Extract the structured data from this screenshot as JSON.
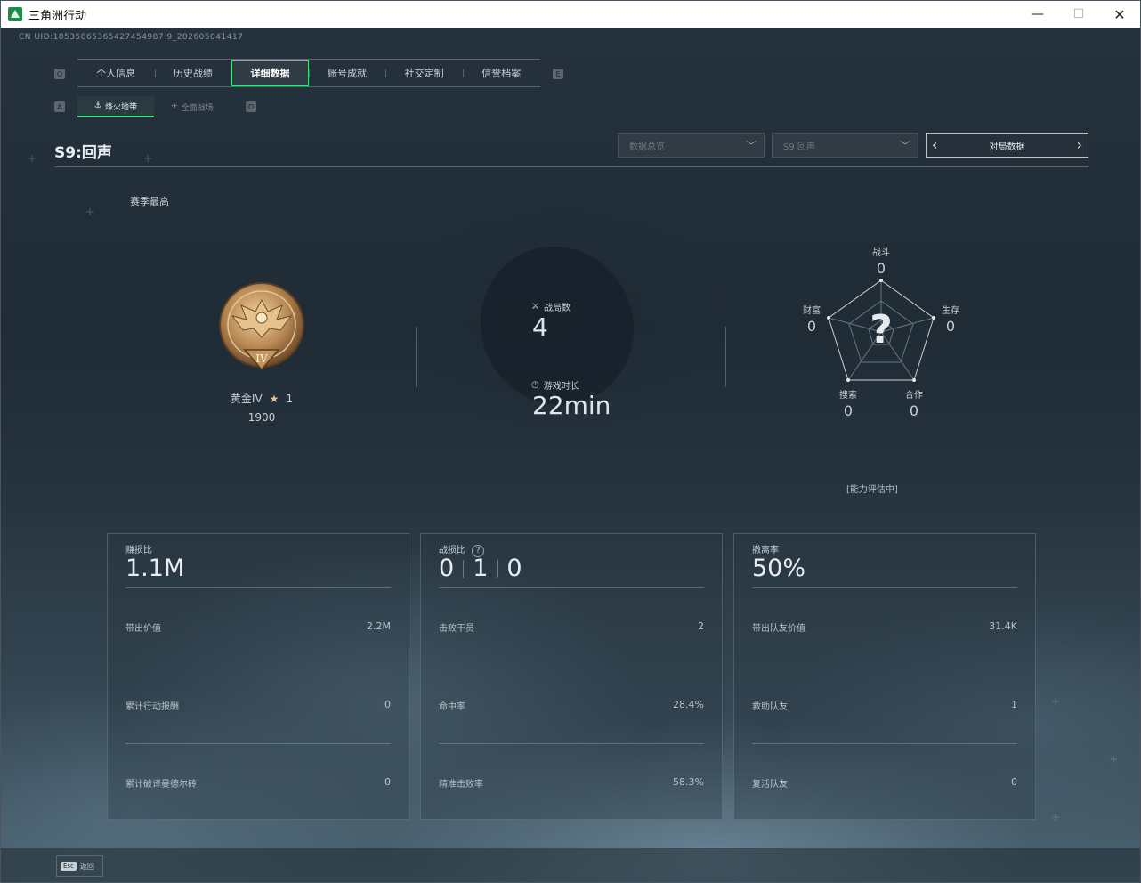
{
  "window": {
    "title": "三角洲行动",
    "min": "—",
    "max": "☐",
    "close": "✕"
  },
  "uid": "CN UID:18535865365427454987 9_202605041417",
  "tabs": {
    "left_key": "Q",
    "right_key": "E",
    "items": [
      "个人信息",
      "历史战绩",
      "详细数据",
      "账号成就",
      "社交定制",
      "信誉档案"
    ],
    "active": "详细数据"
  },
  "subtabs": {
    "left_key": "A",
    "right_key": "D",
    "items": [
      "烽火地带",
      "全面战场"
    ],
    "active": "烽火地带"
  },
  "season_title": "S9:回声",
  "filters": {
    "data_type": "数据总览",
    "season": "S9 回声",
    "match_data": "对局数据"
  },
  "overview": {
    "season_best_label": "赛季最高",
    "rank_name": "黄金IV",
    "rank_stars": "1",
    "rank_score": "1900",
    "matches_label": "战局数",
    "matches_value": "4",
    "playtime_label": "游戏时长",
    "playtime_value": "22min"
  },
  "radar": {
    "combat_label": "战斗",
    "combat_value": "0",
    "survival_label": "生存",
    "survival_value": "0",
    "coop_label": "合作",
    "coop_value": "0",
    "search_label": "搜索",
    "search_value": "0",
    "wealth_label": "财富",
    "wealth_value": "0",
    "center": "?",
    "status": "[能力评估中]"
  },
  "cards": {
    "profit": {
      "label": "赚损比",
      "value": "1.1M",
      "rows": [
        {
          "label": "带出价值",
          "value": "2.2M"
        },
        {
          "label": "累计行动报酬",
          "value": "0"
        },
        {
          "label": "累计破译曼德尔砖",
          "value": "0"
        }
      ]
    },
    "kd": {
      "label": "战损比",
      "help": "?",
      "values": [
        "0",
        "1",
        "0"
      ],
      "rows": [
        {
          "label": "击败干员",
          "value": "2"
        },
        {
          "label": "命中率",
          "value": "28.4%"
        },
        {
          "label": "精准击败率",
          "value": "58.3%"
        }
      ]
    },
    "extract": {
      "label": "撤离率",
      "value": "50%",
      "rows": [
        {
          "label": "带出队友价值",
          "value": "31.4K"
        },
        {
          "label": "救助队友",
          "value": "1"
        },
        {
          "label": "复活队友",
          "value": "0"
        }
      ]
    }
  },
  "footer": {
    "esc_key": "Esc",
    "esc_label": "返回"
  }
}
